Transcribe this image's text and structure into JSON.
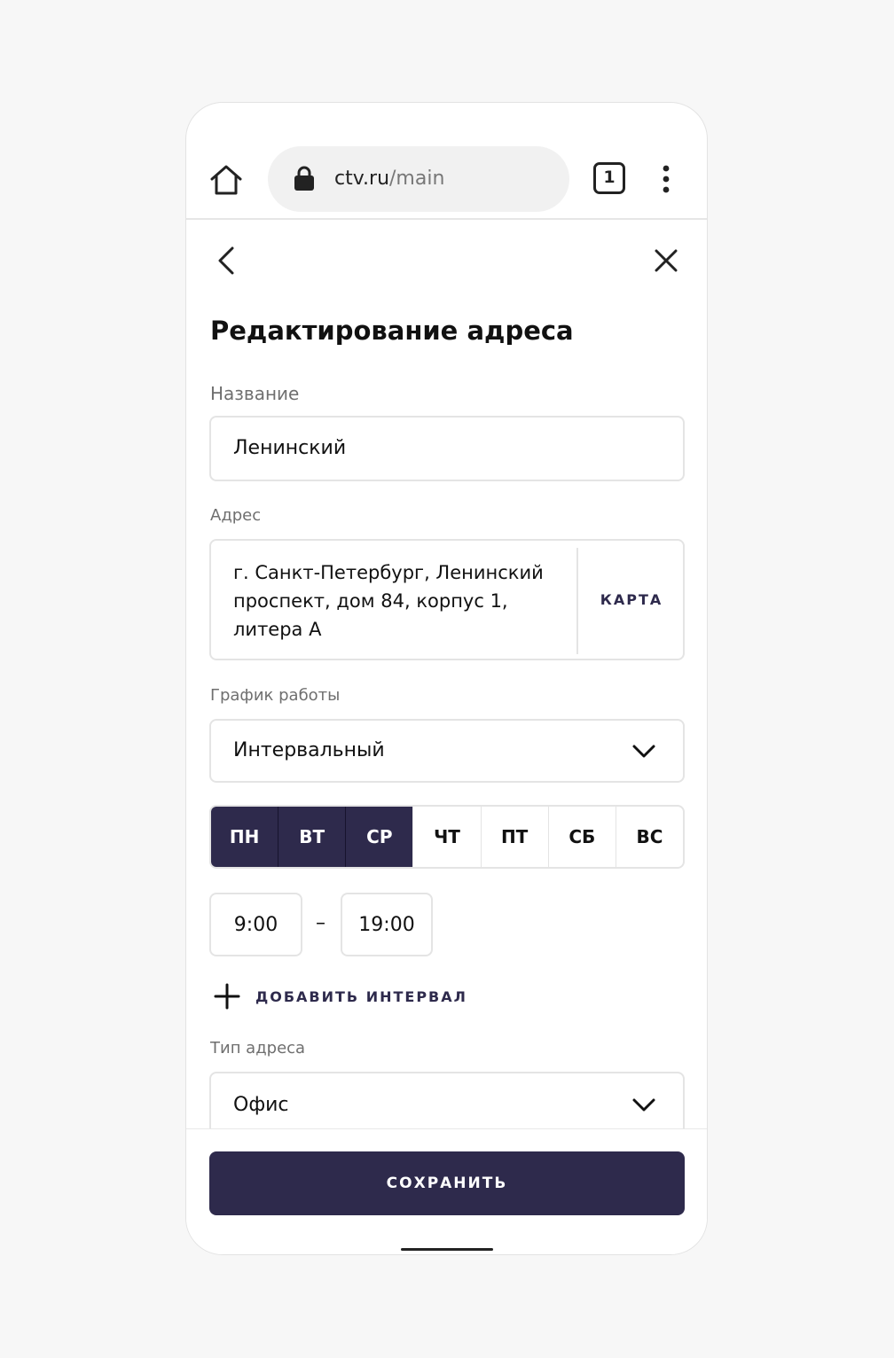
{
  "browser": {
    "url_domain": "ctv.ru",
    "url_path": "/main",
    "tabs_count": "1"
  },
  "page": {
    "title": "Редактирование адреса"
  },
  "form": {
    "name_label": "Название",
    "name_value": "Ленинский",
    "address_label": "Адрес",
    "address_value": "г. Санкт-Петербург, Ленинский проспект, дом 84, корпус 1, литера А",
    "map_button": "КАРТА",
    "schedule_label": "График работы",
    "schedule_value": "Интервальный",
    "days": [
      {
        "label": "ПН",
        "selected": true
      },
      {
        "label": "ВТ",
        "selected": true
      },
      {
        "label": "СР",
        "selected": true
      },
      {
        "label": "ЧТ",
        "selected": false
      },
      {
        "label": "ПТ",
        "selected": false
      },
      {
        "label": "СБ",
        "selected": false
      },
      {
        "label": "ВС",
        "selected": false
      }
    ],
    "time_from": "9:00",
    "time_separator": "–",
    "time_to": "19:00",
    "add_interval": "ДОБАВИТЬ ИНТЕРВАЛ",
    "type_label": "Тип адреса",
    "type_value": "Офис",
    "save_button": "СОХРАНИТЬ"
  },
  "colors": {
    "accent": "#2e2a4c",
    "border": "#e4e4e4",
    "label": "#6f6f6f"
  },
  "icons": {
    "home": "home-icon",
    "lock": "lock-icon",
    "menu": "more-vertical-icon",
    "back": "chevron-left-icon",
    "close": "close-icon",
    "dropdown": "chevron-down-icon",
    "add": "plus-icon"
  }
}
